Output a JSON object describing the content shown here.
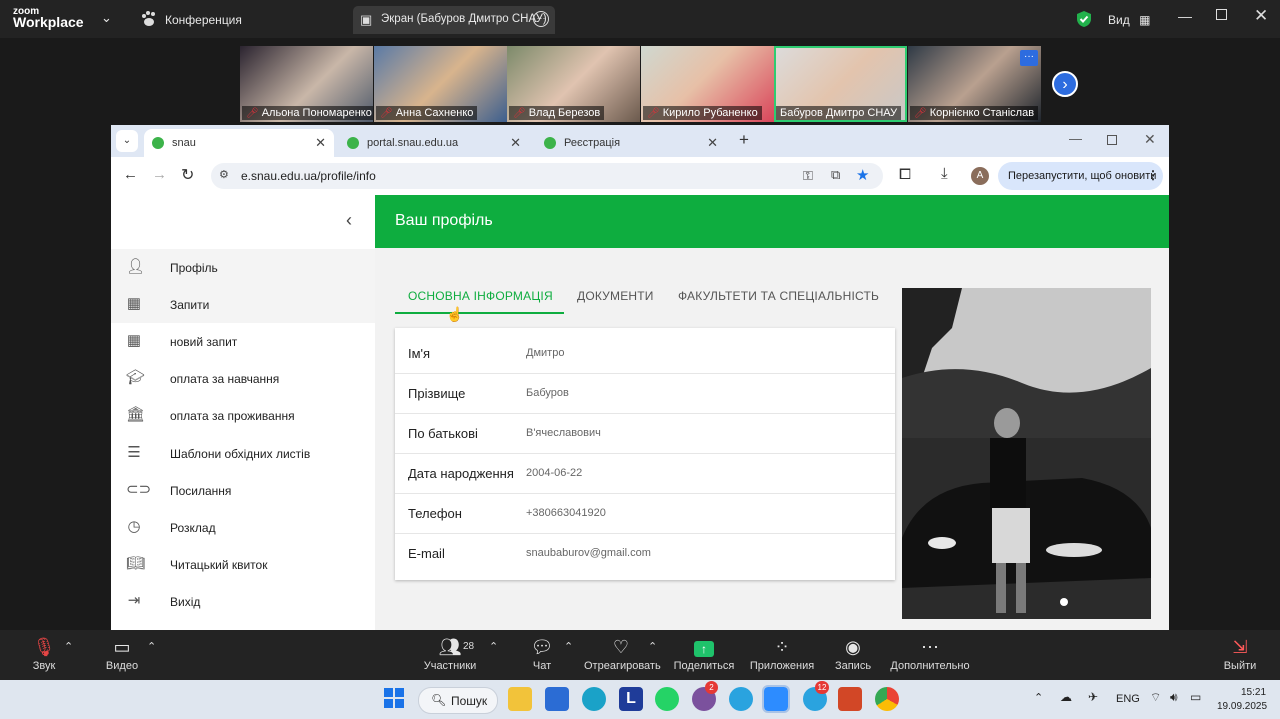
{
  "zoom": {
    "logo_line1": "zoom",
    "logo_line2": "Workplace",
    "chevron": "⌄",
    "conference_label": "Конференция",
    "screen_share_label": "Экран (Бабуров Дмитро СНАУ)",
    "view_label": "Вид",
    "participants": [
      {
        "name": "Альона Пономаренко",
        "muted": true
      },
      {
        "name": "Анна Сахненко",
        "muted": true
      },
      {
        "name": "Влад Березов",
        "muted": true
      },
      {
        "name": "Кирило Рубаненко",
        "muted": true
      },
      {
        "name": "Бабуров Дмитро СНАУ",
        "muted": false
      },
      {
        "name": "Корнієнко Станіслав",
        "muted": true
      }
    ],
    "bottom": {
      "audio": "Звук",
      "video": "Видео",
      "participants": "Участники",
      "participants_count": "28",
      "chat": "Чат",
      "react": "Отреагировать",
      "share": "Поделиться",
      "apps": "Приложения",
      "record": "Запись",
      "more": "Дополнительно",
      "leave": "Выйти"
    }
  },
  "browser": {
    "tabs": [
      {
        "label": "snau"
      },
      {
        "label": "portal.snau.edu.ua"
      },
      {
        "label": "Реєстрація"
      }
    ],
    "new_tab": "+",
    "url": "e.snau.edu.ua/profile/info",
    "restart_label": "Перезапустити, щоб оновити",
    "avatar_letter": "A"
  },
  "page": {
    "banner_title": "Ваш профіль",
    "sidebar": [
      {
        "label": "Профіль",
        "icon": "profile-icon"
      },
      {
        "label": "Запити",
        "icon": "grid-icon"
      },
      {
        "label": "новий запит",
        "icon": "grid-icon"
      },
      {
        "label": "оплата за навчання",
        "icon": "graduation-cap-icon"
      },
      {
        "label": "оплата за проживання",
        "icon": "bank-icon"
      },
      {
        "label": "Шаблони обхідних листів",
        "icon": "list-icon"
      },
      {
        "label": "Посилання",
        "icon": "link-icon"
      },
      {
        "label": "Розклад",
        "icon": "clock-icon"
      },
      {
        "label": "Читацький квиток",
        "icon": "book-reader-icon"
      },
      {
        "label": "Вихід",
        "icon": "logout-icon"
      }
    ],
    "tabs": [
      "ОСНОВНА ІНФОРМАЦІЯ",
      "ДОКУМЕНТИ",
      "ФАКУЛЬТЕТИ ТА СПЕЦІАЛЬНІСТЬ"
    ],
    "fields": [
      {
        "key": "Ім'я",
        "value": "Дмитро"
      },
      {
        "key": "Прізвище",
        "value": "Бабуров"
      },
      {
        "key": "По батькові",
        "value": "В'ячеславович"
      },
      {
        "key": "Дата народження",
        "value": "2004-06-22"
      },
      {
        "key": "Телефон",
        "value": "+380663041920"
      },
      {
        "key": "E-mail",
        "value": "snaubaburov@gmail.com"
      }
    ]
  },
  "taskbar": {
    "search_label": "Пошук",
    "lang": "ENG",
    "time": "15:21",
    "date": "19.09.2025",
    "viber_badge": "2",
    "telegram_badge": "12"
  },
  "colors": {
    "accent_green": "#0ead3f",
    "zoom_bg": "#232323"
  }
}
